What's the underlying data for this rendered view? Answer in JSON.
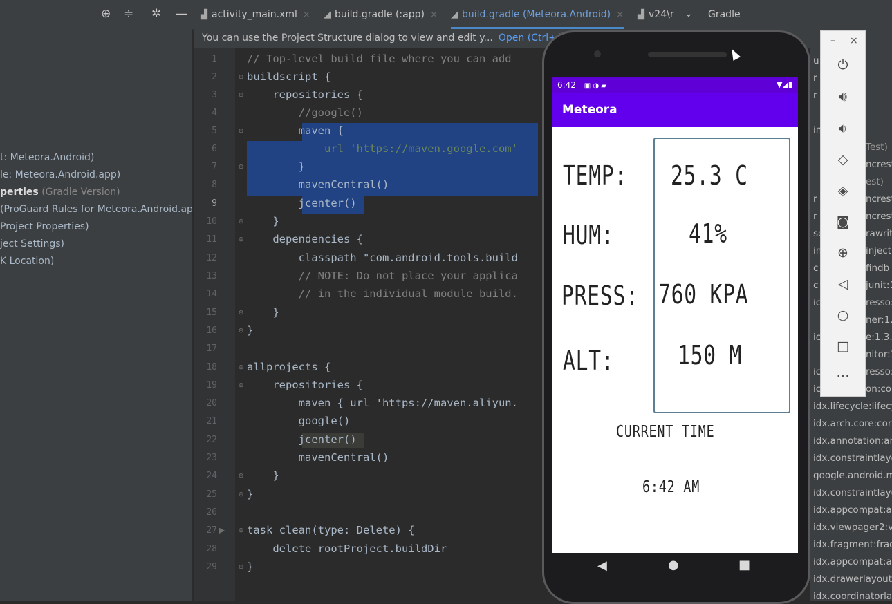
{
  "tabs": [
    {
      "label": "activity_main.xml",
      "icon": "xml-file-icon"
    },
    {
      "label": "build.gradle (:app)",
      "icon": "gradle-icon"
    },
    {
      "label": "build.gradle (Meteora.Android)",
      "icon": "gradle-icon"
    },
    {
      "label": "v24\\r",
      "icon": "xml-file-icon"
    }
  ],
  "gradle_tool_label": "Gradle",
  "project_panel": {
    "items": [
      {
        "text": "t: Meteora.Android)"
      },
      {
        "text": "le: Meteora.Android.app)"
      },
      {
        "bold": "perties",
        "dim": " (Gradle Version)"
      },
      {
        "text": "(ProGuard Rules for Meteora.Android.app"
      },
      {
        "text": "Project Properties)"
      },
      {
        "text": "ject Settings)"
      },
      {
        "text": "K Location)"
      }
    ]
  },
  "notice": {
    "text": "You can use the Project Structure dialog to view and edit y...",
    "link": "Open (Ctrl+Alt"
  },
  "editor": {
    "line_numbers": [
      "1",
      "2",
      "3",
      "4",
      "5",
      "6",
      "7",
      "8",
      "9",
      "10",
      "11",
      "12",
      "13",
      "14",
      "15",
      "16",
      "17",
      "18",
      "19",
      "20",
      "21",
      "22",
      "23",
      "24",
      "25",
      "26",
      "27",
      "28",
      "29"
    ],
    "lines": [
      "// Top-level build file where you can add",
      "buildscript {",
      "    repositories {",
      "        //google()",
      "        maven {",
      "            url 'https://maven.google.com'",
      "        }",
      "        mavenCentral()",
      "        jcenter()",
      "    }",
      "    dependencies {",
      "        classpath \"com.android.tools.build",
      "        // NOTE: Do not place your applica",
      "        // in the individual module build.",
      "    }",
      "}",
      "",
      "allprojects {",
      "    repositories {",
      "        maven { url 'https://maven.aliyun.",
      "        google()",
      "        jcenter()",
      "        mavenCentral()",
      "    }",
      "}",
      "",
      "task clean(type: Delete) {",
      "    delete rootProject.buildDir",
      "}"
    ]
  },
  "phone": {
    "status_time": "6:42",
    "app_title": "Meteora",
    "labels": {
      "temp": "TEMP:",
      "hum": "HUM:",
      "press": "PRESS:",
      "alt": "ALT:"
    },
    "values": {
      "temp": "25.3 C",
      "hum": "41%",
      "press": "760 KPA",
      "alt": "150 M"
    },
    "current_time_label": "CURRENT TIME",
    "current_time_value": "6:42 AM",
    "accent_color": "#6200ee"
  },
  "emulator_toolbar": {
    "buttons": [
      "power-icon",
      "volume-up-icon",
      "volume-down-icon",
      "rotate-left-icon",
      "rotate-right-icon",
      "camera-icon",
      "zoom-icon",
      "back-icon",
      "home-icon",
      "overview-icon",
      "more-icon"
    ]
  },
  "dependencies_panel": {
    "col1": [
      "u",
      "r",
      "r",
      "in",
      "r",
      "r",
      "sq",
      "in",
      "c",
      "c",
      "ic",
      "ic",
      "ic",
      "ic",
      "idx.lifecycle:lifecy",
      "idx.arch.core:core",
      "idx.annotation:an",
      "idx.constraintlayo",
      "google.android.m",
      "idx.constraintlayo",
      "idx.appcompat:ap",
      "idx.viewpager2:vi",
      "idx.fragment:frag",
      "idx.appcompat:ap",
      "idx.drawerlayout:",
      "idx.coordinatorla"
    ],
    "col2": [
      "Test)",
      "ncrest",
      "est)",
      "ncrest",
      "ncrest",
      "rawrit",
      "inject",
      "findb",
      "junit:1",
      "resso:",
      "ner:1.3",
      "e:1.3.0",
      "nitor:1",
      "resso:",
      "on:col"
    ]
  }
}
